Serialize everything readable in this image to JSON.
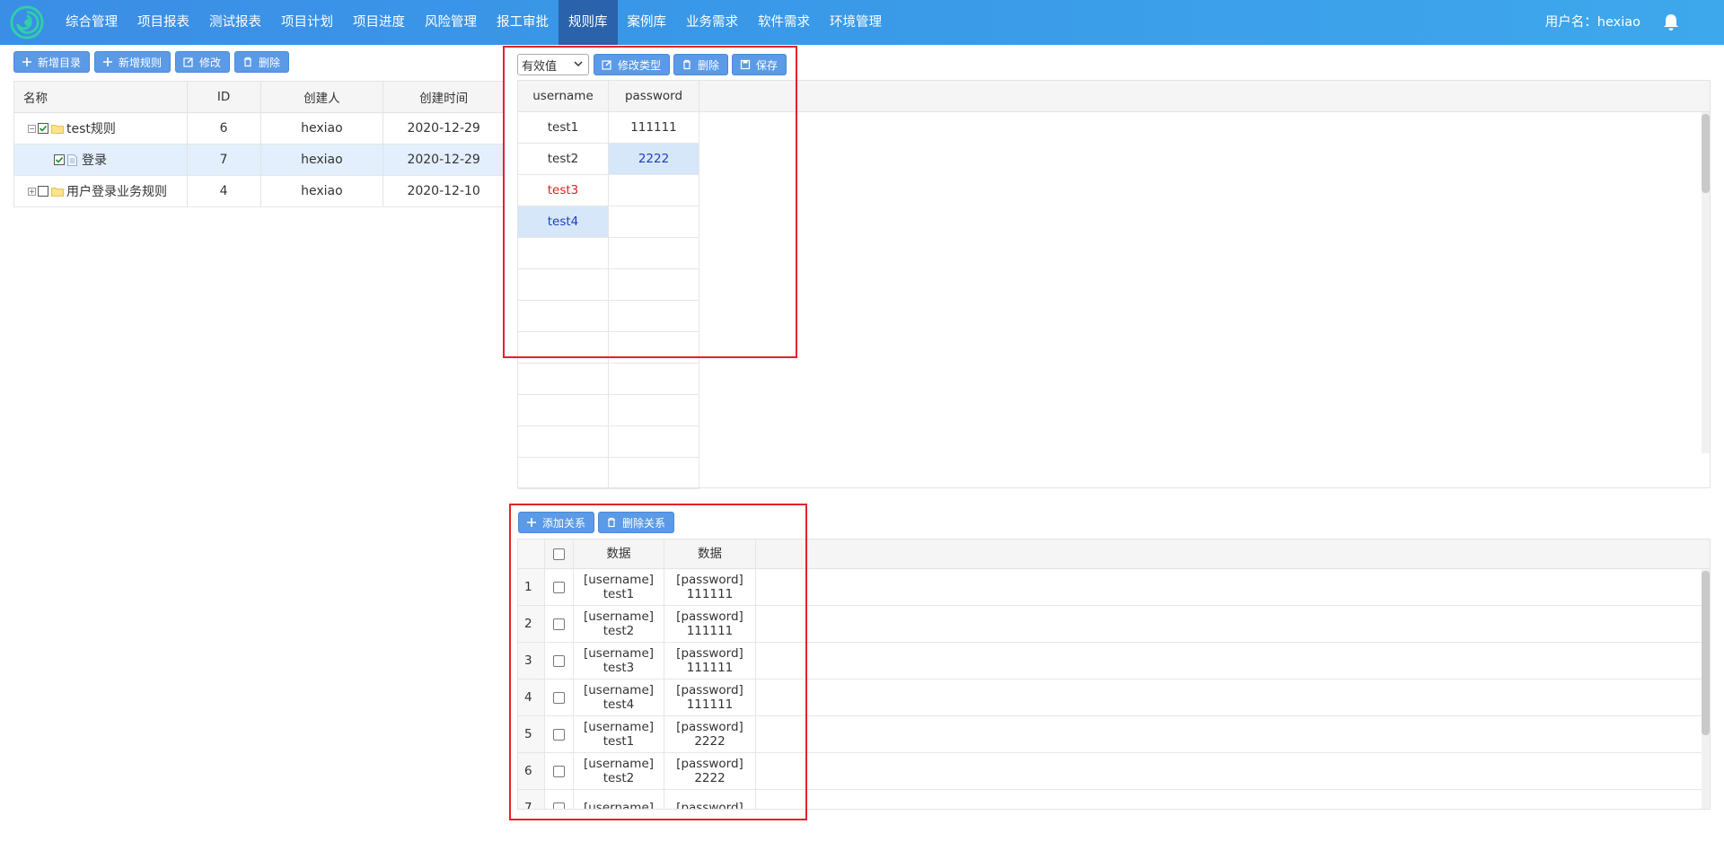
{
  "nav": {
    "items": [
      "综合管理",
      "项目报表",
      "测试报表",
      "项目计划",
      "项目进度",
      "风险管理",
      "报工审批",
      "规则库",
      "案例库",
      "业务需求",
      "软件需求",
      "环境管理"
    ],
    "active_index": 7,
    "user_label": "用户名：hexiao",
    "bell_icon": "bell-icon",
    "logo_icon": "swirl-logo-icon"
  },
  "left_toolbar": {
    "add_dir": "新增目录",
    "add_rule": "新增规则",
    "edit": "修改",
    "delete": "删除"
  },
  "tree": {
    "headers": [
      "名称",
      "ID",
      "创建人",
      "创建时间"
    ],
    "rows": [
      {
        "name": "test规则",
        "id": "6",
        "creator": "hexiao",
        "date": "2020-12-29",
        "type": "folder",
        "expand": "⊟",
        "checked": true
      },
      {
        "name": "登录",
        "id": "7",
        "creator": "hexiao",
        "date": "2020-12-29",
        "type": "file",
        "checked": true,
        "selected": true
      },
      {
        "name": "用户登录业务规则",
        "id": "4",
        "creator": "hexiao",
        "date": "2020-12-10",
        "type": "folder",
        "expand": "⊞",
        "checked": false
      }
    ]
  },
  "data_toolbar": {
    "select_value": "有效值",
    "modify_type": "修改类型",
    "delete": "删除",
    "save": "保存"
  },
  "data_table": {
    "headers": [
      "username",
      "password"
    ],
    "rows": [
      [
        "test1",
        "111111"
      ],
      [
        "test2",
        "2222"
      ],
      [
        "test3",
        ""
      ],
      [
        "test4",
        ""
      ],
      [
        "",
        ""
      ],
      [
        "",
        ""
      ],
      [
        "",
        ""
      ],
      [
        "",
        ""
      ],
      [
        "",
        ""
      ],
      [
        "",
        ""
      ],
      [
        "",
        ""
      ],
      [
        "",
        ""
      ]
    ]
  },
  "rel_toolbar": {
    "add": "添加关系",
    "delete": "删除关系"
  },
  "rel_table": {
    "headers": [
      "数据",
      "数据"
    ],
    "rows": [
      {
        "n": "1",
        "a1": "[username]",
        "a2": "test1",
        "b1": "[password]",
        "b2": "111111"
      },
      {
        "n": "2",
        "a1": "[username]",
        "a2": "test2",
        "b1": "[password]",
        "b2": "111111"
      },
      {
        "n": "3",
        "a1": "[username]",
        "a2": "test3",
        "b1": "[password]",
        "b2": "111111"
      },
      {
        "n": "4",
        "a1": "[username]",
        "a2": "test4",
        "b1": "[password]",
        "b2": "111111"
      },
      {
        "n": "5",
        "a1": "[username]",
        "a2": "test1",
        "b1": "[password]",
        "b2": "2222"
      },
      {
        "n": "6",
        "a1": "[username]",
        "a2": "test2",
        "b1": "[password]",
        "b2": "2222"
      },
      {
        "n": "7",
        "a1": "[username]",
        "a2": "",
        "b1": "[password]",
        "b2": ""
      }
    ]
  },
  "colors": {
    "nav_bg": "#3b8ee6",
    "nav_active": "#2a63ac",
    "button": "#5b9ae6",
    "annotation_red": "#e6202a",
    "cell_red": "#e02020",
    "cell_blue": "#1a3fc2"
  }
}
